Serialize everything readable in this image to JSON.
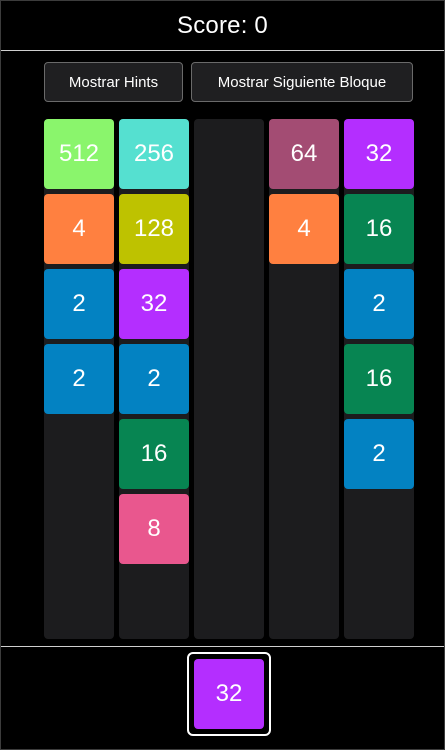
{
  "header": {
    "score_label": "Score: 0"
  },
  "buttons": {
    "hints": "Mostrar Hints",
    "next_block": "Mostrar Siguiente Bloque"
  },
  "colors": {
    "2": "#0382c2",
    "4": "#ff8040",
    "8": "#e9578e",
    "16": "#078552",
    "32": "#b42eff",
    "64": "#a34c73",
    "128": "#bec200",
    "256": "#55e0d0",
    "512": "#8af56c"
  },
  "columns": [
    {
      "tiles": [
        "512",
        "4",
        "2",
        "2"
      ]
    },
    {
      "tiles": [
        "256",
        "128",
        "32",
        "2",
        "16",
        "8"
      ]
    },
    {
      "tiles": []
    },
    {
      "tiles": [
        "64",
        "4"
      ]
    },
    {
      "tiles": [
        "32",
        "16",
        "2",
        "16",
        "2"
      ]
    }
  ],
  "next_block": {
    "value": "32"
  }
}
